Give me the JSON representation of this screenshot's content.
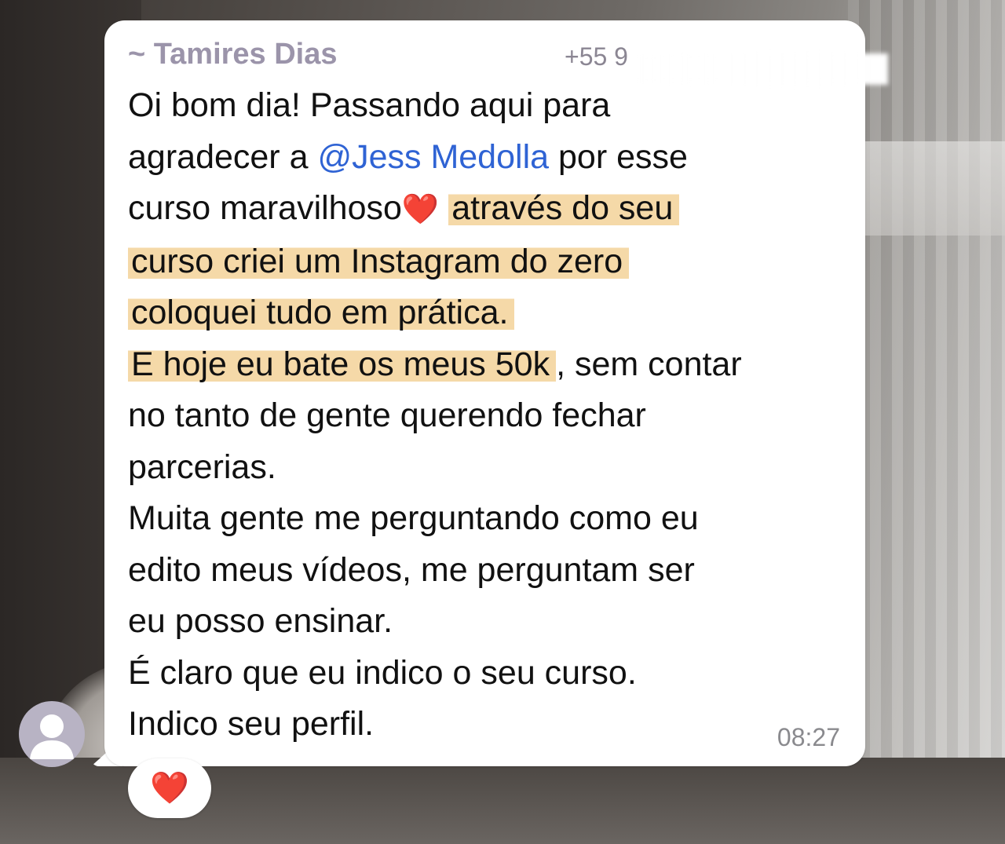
{
  "chat": {
    "sender": {
      "name": "~ Tamires Dias",
      "phone_visible": "+55 9",
      "name_color": "#9b94aa"
    },
    "message": {
      "segments": [
        {
          "text": "Oi bom dia! Passando aqui para\nagradecer a ",
          "style": "plain"
        },
        {
          "text": "@Jess Medolla",
          "style": "mention"
        },
        {
          "text": " por esse\ncurso maravilhoso",
          "style": "plain"
        },
        {
          "text": "❤️",
          "style": "emoji"
        },
        {
          "text": " ",
          "style": "plain"
        },
        {
          "text": "através do seu\ncurso criei um Instagram do zero\ncoloquei tudo em prática.",
          "style": "highlight"
        },
        {
          "text": "\n",
          "style": "plain"
        },
        {
          "text": "E hoje eu bate os meus 50k",
          "style": "highlight"
        },
        {
          "text": ", sem contar\nno tanto de gente querendo fechar\nparcerias.\nMuita gente me perguntando como eu\nedito meus vídeos, me perguntam ser\neu posso ensinar.\nÉ claro que eu indico o seu curso.\nIndico seu perfil.",
          "style": "plain"
        }
      ],
      "time": "08:27",
      "mention_color": "#2f63d4",
      "highlight_color": "#f5d9a8"
    },
    "reaction": {
      "emoji": "❤️"
    },
    "avatar": {
      "icon": "default-user-avatar-icon",
      "color": "#b8b3c4"
    }
  }
}
